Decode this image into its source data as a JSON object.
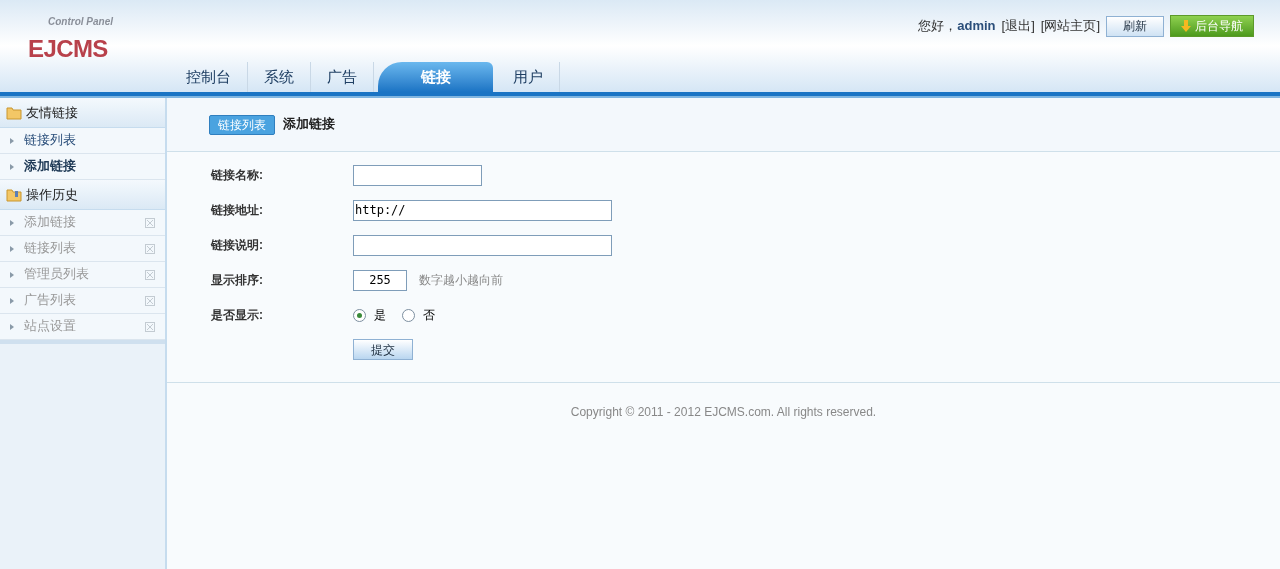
{
  "header": {
    "logo_subtitle": "Control Panel",
    "logo": "EJCMS",
    "greeting": "您好，",
    "user": "admin",
    "links": [
      "[退出]",
      "[网站主页]"
    ],
    "refresh_button": "刷新",
    "nav_button": "后台导航"
  },
  "nav_tabs": [
    {
      "label": "控制台",
      "selected": false
    },
    {
      "label": "系统",
      "selected": false
    },
    {
      "label": "广告",
      "selected": false
    },
    {
      "label": "链接",
      "selected": true
    },
    {
      "label": "用户",
      "selected": false
    }
  ],
  "sidebar": [
    {
      "title": "友情链接",
      "kind": "menu",
      "items": [
        {
          "label": "链接列表",
          "selected": false
        },
        {
          "label": "添加链接",
          "selected": true
        }
      ]
    },
    {
      "title": "操作历史",
      "kind": "history",
      "items": [
        {
          "label": "添加链接",
          "selected": false
        },
        {
          "label": "链接列表",
          "selected": false
        },
        {
          "label": "管理员列表",
          "selected": false
        },
        {
          "label": "广告列表",
          "selected": false
        },
        {
          "label": "站点设置",
          "selected": false
        }
      ]
    }
  ],
  "content": {
    "list_button": "链接列表",
    "title": "添加链接",
    "fields": [
      {
        "label": "链接名称:",
        "kind": "short"
      },
      {
        "label": "链接地址:",
        "kind": "long",
        "value": "http://"
      },
      {
        "label": "链接说明:",
        "kind": "long"
      },
      {
        "label": "显示排序:",
        "kind": "number",
        "value": "255",
        "hint": "数字越小越向前"
      },
      {
        "label": "是否显示:",
        "kind": "radio",
        "options": [
          {
            "label": "是",
            "selected": true
          },
          {
            "label": "否",
            "selected": false
          }
        ]
      }
    ],
    "submit": "提交"
  },
  "footer": "Copyright © 2011 - 2012 EJCMS.com. All rights reserved."
}
